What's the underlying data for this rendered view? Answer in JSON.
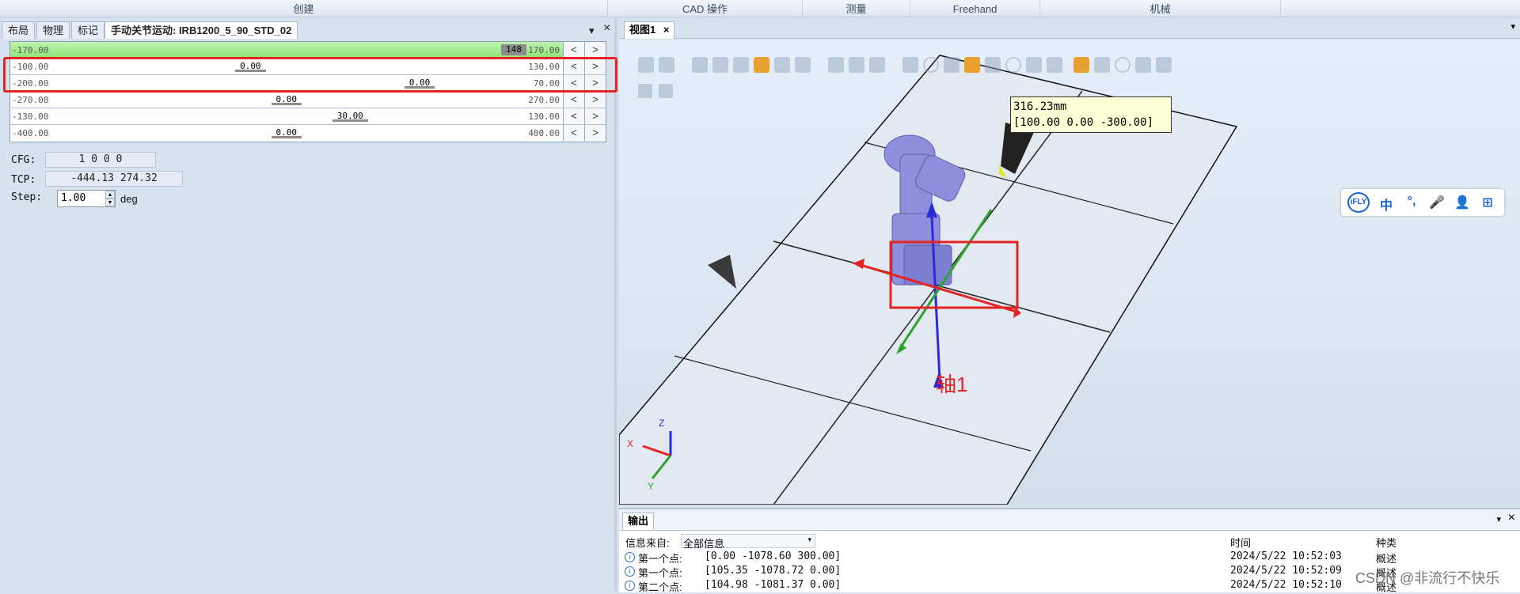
{
  "ribbon": {
    "groups": [
      "创建",
      "CAD 操作",
      "测量",
      "Freehand",
      "机械"
    ]
  },
  "left_panel": {
    "tabs": [
      "布局",
      "物理",
      "标记",
      "手动关节运动: IRB1200_5_90_STD_02"
    ],
    "pin_glyph": "▾",
    "close_glyph": "×",
    "joints": [
      {
        "min": "-170.00",
        "value": "148",
        "max": "170.00",
        "fraction": 0.935
      },
      {
        "min": "-100.00",
        "value": "0.00",
        "max": "130.00",
        "fraction": 0.435
      },
      {
        "min": "-200.00",
        "value": "0.00",
        "max": "70.00",
        "fraction": 0.741
      },
      {
        "min": "-270.00",
        "value": "0.00",
        "max": "270.00",
        "fraction": 0.5
      },
      {
        "min": "-130.00",
        "value": "30.00",
        "max": "130.00",
        "fraction": 0.615
      },
      {
        "min": "-400.00",
        "value": "0.00",
        "max": "400.00",
        "fraction": 0.5
      }
    ],
    "btn_left": "<",
    "btn_right": ">",
    "cfg_label": "CFG:",
    "cfg_value": "1 0 0 0",
    "tcp_label": "TCP:",
    "tcp_value": "-444.13 274.32",
    "step_label": "Step:",
    "step_value": "1.00",
    "step_unit": "deg"
  },
  "view": {
    "tab_label": "视图1",
    "tab_close": "×",
    "tooltip_line1": "316.23mm",
    "tooltip_line2": "[100.00 0.00 -300.00]",
    "axis_annotation": "轴1",
    "gizmo_x": "X",
    "gizmo_y": "Y",
    "gizmo_z": "Z"
  },
  "ifly": {
    "items": [
      "iFLY",
      "中",
      "°,",
      "🎤",
      "👤",
      "⊞"
    ]
  },
  "output": {
    "tab_label": "输出",
    "source_label": "信息来自:",
    "source_value": "全部信息",
    "col_time": "时间",
    "col_kind": "种类",
    "rows": [
      {
        "name": "第一个点:",
        "coords": "[0.00 -1078.60 300.00]",
        "time": "2024/5/22 10:52:03",
        "kind": "概述"
      },
      {
        "name": "第一个点:",
        "coords": "[105.35 -1078.72 0.00]",
        "time": "2024/5/22 10:52:09",
        "kind": "概述"
      },
      {
        "name": "第二个点:",
        "coords": "[104.98 -1081.37 0.00]",
        "time": "2024/5/22 10:52:10",
        "kind": "概述"
      }
    ]
  },
  "watermark": "CSDN @非流行不快乐"
}
